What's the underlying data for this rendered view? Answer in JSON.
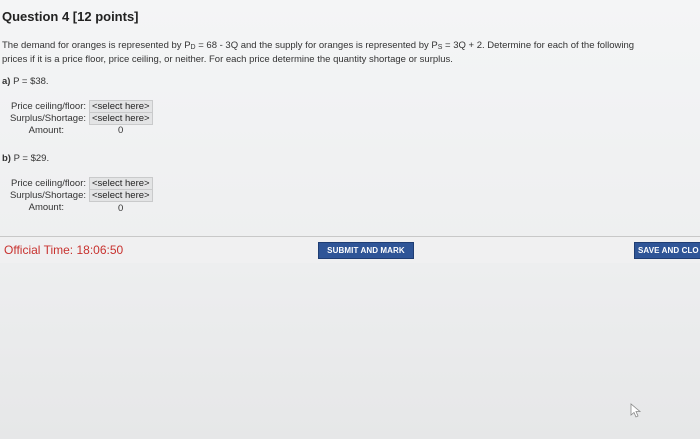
{
  "question": {
    "title": "Question 4 [12 points]"
  },
  "prompt": {
    "line1_a": "The demand for oranges is represented by P",
    "line1_sub1": "D",
    "line1_b": " = 68 - 3Q and the supply for oranges is represented by P",
    "line1_sub2": "S",
    "line1_c": " = 3Q + 2. Determine for each of the following",
    "line2": "prices if it is a price floor, price ceiling, or neither. For each price determine the quantity shortage or surplus."
  },
  "parts": [
    {
      "letter": "a)",
      "price": " P = $38.",
      "ceiling_floor_label": "Price ceiling/floor:",
      "ceiling_floor_value": "<select here>",
      "surplus_shortage_label": "Surplus/Shortage:",
      "surplus_shortage_value": "<select here>",
      "amount_label": "Amount:",
      "amount_value": "0"
    },
    {
      "letter": "b)",
      "price": " P = $29.",
      "ceiling_floor_label": "Price ceiling/floor:",
      "ceiling_floor_value": "<select here>",
      "surplus_shortage_label": "Surplus/Shortage:",
      "surplus_shortage_value": "<select here>",
      "amount_label": "Amount:",
      "amount_value": "0"
    }
  ],
  "footer": {
    "timer_label": "Official Time: ",
    "timer_value": "18:06:50",
    "submit_label": "SUBMIT AND MARK",
    "save_label": "SAVE AND CLO"
  },
  "colors": {
    "timer": "#c8322f",
    "button": "#2f5597"
  },
  "icons": {
    "cursor": "mouse-pointer-icon"
  }
}
